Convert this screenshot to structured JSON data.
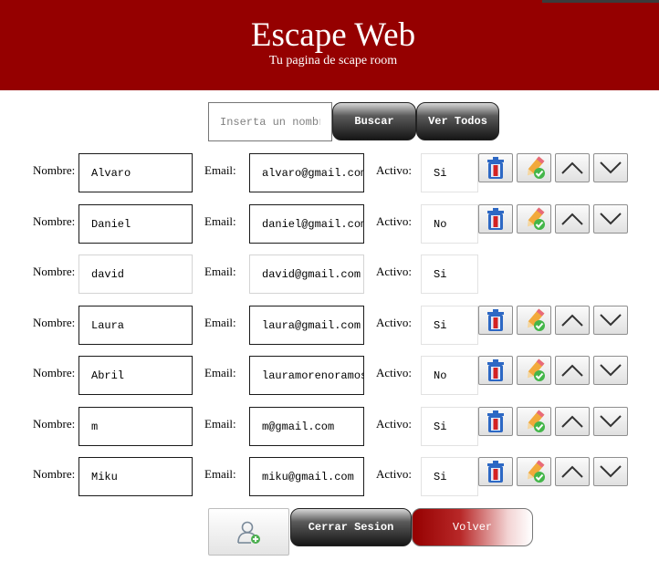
{
  "header": {
    "title": "Escape Web",
    "subtitle": "Tu pagina de scape room",
    "background": "#950000"
  },
  "search": {
    "placeholder": "Inserta un nombre",
    "search_label": "Buscar",
    "show_all_label": "Ver Todos"
  },
  "labels": {
    "name": "Nombre:",
    "email": "Email:",
    "active": "Activo:"
  },
  "users": [
    {
      "name": "Alvaro",
      "email": "alvaro@gmail.com",
      "active": "Si",
      "editable": true
    },
    {
      "name": "Daniel",
      "email": "daniel@gmail.com",
      "active": "No",
      "editable": true
    },
    {
      "name": "david",
      "email": "david@gmail.com",
      "active": "Si",
      "editable": false
    },
    {
      "name": "Laura",
      "email": "laura@gmail.com",
      "active": "Si",
      "editable": true
    },
    {
      "name": "Abril",
      "email": "lauramorenoramos@gmail.com",
      "active": "No",
      "editable": true
    },
    {
      "name": "m",
      "email": "m@gmail.com",
      "active": "Si",
      "editable": true
    },
    {
      "name": "Miku",
      "email": "miku@gmail.com",
      "active": "Si",
      "editable": true
    }
  ],
  "row_icons": [
    "delete-bin-icon",
    "edit-pencil-icon",
    "chevron-up-icon",
    "chevron-down-icon"
  ],
  "footer": {
    "add_user_icon": "add-user-icon",
    "logout_label": "Cerrar Sesion",
    "back_label": "Volver"
  }
}
